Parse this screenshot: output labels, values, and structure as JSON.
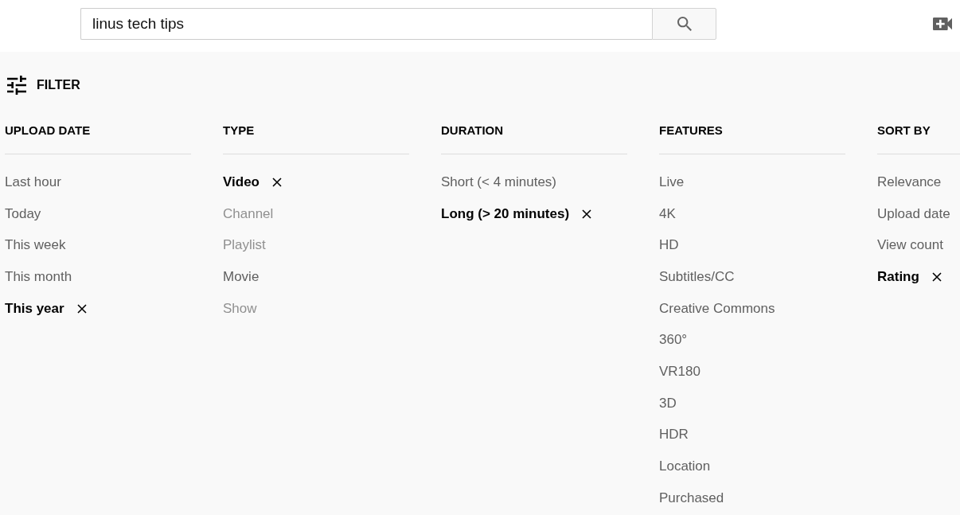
{
  "search": {
    "value": "linus tech tips"
  },
  "filter": {
    "label": "FILTER"
  },
  "groups": [
    {
      "heading": "UPLOAD DATE",
      "items": [
        {
          "label": "Last hour",
          "selected": false,
          "disabled": false
        },
        {
          "label": "Today",
          "selected": false,
          "disabled": false
        },
        {
          "label": "This week",
          "selected": false,
          "disabled": false
        },
        {
          "label": "This month",
          "selected": false,
          "disabled": false
        },
        {
          "label": "This year",
          "selected": true,
          "disabled": false
        }
      ]
    },
    {
      "heading": "TYPE",
      "items": [
        {
          "label": "Video",
          "selected": true,
          "disabled": false
        },
        {
          "label": "Channel",
          "selected": false,
          "disabled": true
        },
        {
          "label": "Playlist",
          "selected": false,
          "disabled": true
        },
        {
          "label": "Movie",
          "selected": false,
          "disabled": false
        },
        {
          "label": "Show",
          "selected": false,
          "disabled": true
        }
      ]
    },
    {
      "heading": "DURATION",
      "items": [
        {
          "label": "Short (< 4 minutes)",
          "selected": false,
          "disabled": false
        },
        {
          "label": "Long (> 20 minutes)",
          "selected": true,
          "disabled": false
        }
      ]
    },
    {
      "heading": "FEATURES",
      "items": [
        {
          "label": "Live",
          "selected": false,
          "disabled": false
        },
        {
          "label": "4K",
          "selected": false,
          "disabled": false
        },
        {
          "label": "HD",
          "selected": false,
          "disabled": false
        },
        {
          "label": "Subtitles/CC",
          "selected": false,
          "disabled": false
        },
        {
          "label": "Creative Commons",
          "selected": false,
          "disabled": false
        },
        {
          "label": "360°",
          "selected": false,
          "disabled": false
        },
        {
          "label": "VR180",
          "selected": false,
          "disabled": false
        },
        {
          "label": "3D",
          "selected": false,
          "disabled": false
        },
        {
          "label": "HDR",
          "selected": false,
          "disabled": false
        },
        {
          "label": "Location",
          "selected": false,
          "disabled": false
        },
        {
          "label": "Purchased",
          "selected": false,
          "disabled": false
        }
      ]
    },
    {
      "heading": "SORT BY",
      "items": [
        {
          "label": "Relevance",
          "selected": false,
          "disabled": false
        },
        {
          "label": "Upload date",
          "selected": false,
          "disabled": false
        },
        {
          "label": "View count",
          "selected": false,
          "disabled": false
        },
        {
          "label": "Rating",
          "selected": true,
          "disabled": false
        }
      ]
    }
  ]
}
